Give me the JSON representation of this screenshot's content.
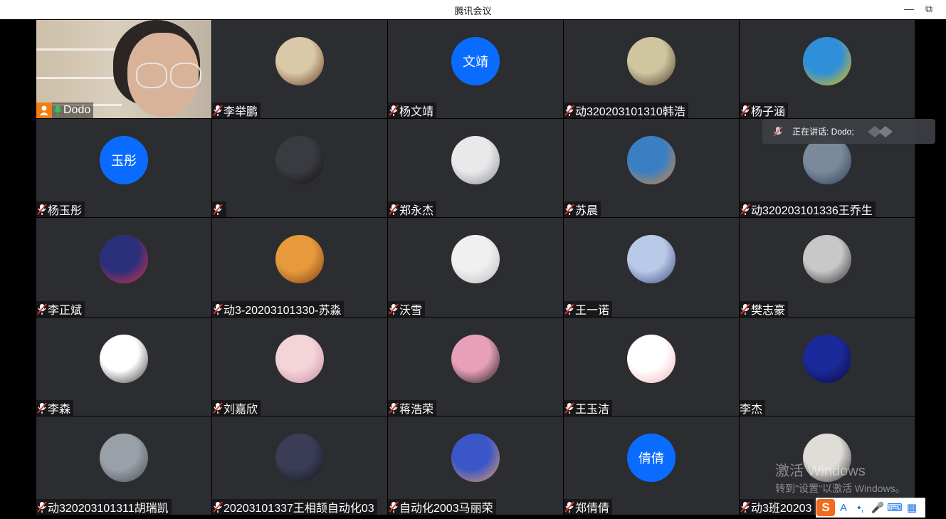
{
  "window": {
    "title": "腾讯会议"
  },
  "speaking": {
    "text": "正在讲话: Dodo;"
  },
  "watermark": {
    "line1": "激活 Windows",
    "line2": "转到\"设置\"以激活 Windows。"
  },
  "ime": {
    "logo": "S",
    "k1": "A",
    "k2": "•,",
    "k3": "🎤",
    "k4": "⌨",
    "k5": "▦"
  },
  "participants": [
    {
      "name": "Dodo",
      "avatar": "video"
    },
    {
      "name": "李举鹏",
      "avatar": "img",
      "c1": "#d9c9a8",
      "c2": "#6b3a20"
    },
    {
      "name": "杨文靖",
      "avatar": "text",
      "text": "文靖"
    },
    {
      "name": "动320203101310韩浩",
      "avatar": "img",
      "c1": "#cfc6a0",
      "c2": "#4a3b2a"
    },
    {
      "name": "杨子涵",
      "avatar": "img",
      "c1": "#2f8fd8",
      "c2": "#f0c000"
    },
    {
      "name": "杨玉彤",
      "avatar": "text",
      "text": "玉彤"
    },
    {
      "name": "",
      "avatar": "img",
      "c1": "#3a3b40",
      "c2": "#111114"
    },
    {
      "name": "郑永杰",
      "avatar": "img",
      "c1": "#e9e9ea",
      "c2": "#8b8d94"
    },
    {
      "name": "苏晨",
      "avatar": "img",
      "c1": "#3a7fc2",
      "c2": "#d88a3a"
    },
    {
      "name": "动320203101336王乔生",
      "avatar": "img",
      "c1": "#7a8a9a",
      "c2": "#2d3b55"
    },
    {
      "name": "李正斌",
      "avatar": "img",
      "c1": "#2a2f7a",
      "c2": "#e0304a"
    },
    {
      "name": "动3-20203101330-苏淼",
      "avatar": "img",
      "c1": "#e79a3c",
      "c2": "#7a3e12"
    },
    {
      "name": "沃雪",
      "avatar": "img",
      "c1": "#f0f0f0",
      "c2": "#b8b8b8"
    },
    {
      "name": "王一诺",
      "avatar": "img",
      "c1": "#b9c9e8",
      "c2": "#3b4a7a"
    },
    {
      "name": "樊志豪",
      "avatar": "img",
      "c1": "#c8c8c8",
      "c2": "#2a2a2a"
    },
    {
      "name": "李森",
      "avatar": "img",
      "c1": "#ffffff",
      "c2": "#333333"
    },
    {
      "name": "刘嘉欣",
      "avatar": "img",
      "c1": "#f3d4d8",
      "c2": "#c88aa0"
    },
    {
      "name": "蒋浩荣",
      "avatar": "img",
      "c1": "#e8a0b8",
      "c2": "#1a1a1a"
    },
    {
      "name": "王玉洁",
      "avatar": "img",
      "c1": "#ffffff",
      "c2": "#f0b0b8"
    },
    {
      "name": "李杰",
      "avatar": "img",
      "c1": "#1a2a9a",
      "c2": "#0a0a3a",
      "nomic": true
    },
    {
      "name": "动320203101311胡瑞凯",
      "avatar": "img",
      "c1": "#9aa0a8",
      "c2": "#4a4e55"
    },
    {
      "name": "20203101337王相颉自动化03",
      "avatar": "img",
      "c1": "#3a3d55",
      "c2": "#121320"
    },
    {
      "name": "自动化2003马丽荣",
      "avatar": "img",
      "c1": "#3a56c8",
      "c2": "#e8a060"
    },
    {
      "name": "郑倩倩",
      "avatar": "text",
      "text": "倩倩"
    },
    {
      "name": "动3班20203",
      "avatar": "img",
      "c1": "#e0ddd8",
      "c2": "#2a2a2a"
    }
  ]
}
